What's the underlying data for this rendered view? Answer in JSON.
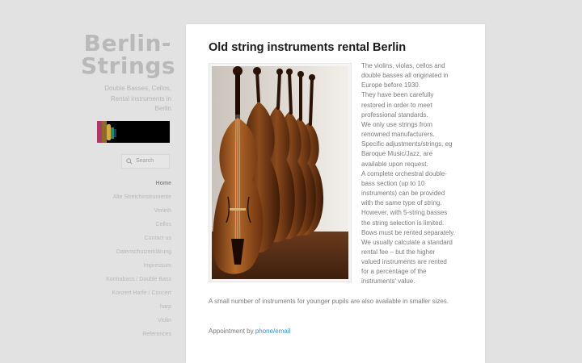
{
  "site": {
    "title_lines": [
      "Berlin-",
      "Strings"
    ],
    "description_lines": [
      "Double Basses, Cellos,",
      "Rental instruments in",
      "Berlin"
    ]
  },
  "search": {
    "placeholder": "Search"
  },
  "nav": {
    "items": [
      {
        "label": "Home"
      },
      {
        "label": "Alte Streichinstrumente"
      },
      {
        "label": "Verleih"
      },
      {
        "label": "Cellos"
      },
      {
        "label": "Contact us"
      },
      {
        "label": "Datenschutzerklärung"
      },
      {
        "label": "Impressum"
      },
      {
        "label": "Kontrabass / Double Bass"
      },
      {
        "label": "Konzert Harfe / Concert"
      },
      {
        "label": "harp"
      },
      {
        "label": "Violin"
      },
      {
        "label": "References"
      }
    ]
  },
  "page": {
    "title": "Old string instruments rental Berlin",
    "body_lines": [
      "The violins, violas, cellos and",
      "double basses all originated in",
      "Europe before 1930.",
      "They have been carefully",
      "restored in order to meet",
      "professional standards.",
      "We only use strings from",
      "renowned manufacturers.",
      "Specific adjustments/strings, eg",
      "Baroque Music/Jazz, are",
      "available upon request.",
      "A complete orchestral double-",
      "bass section (up to 10",
      "instruments) can be provided",
      "with the same type of string.",
      "However, with 5-string basses",
      "the string selection is limited.",
      "Bows must be rented separately.",
      "We usually calculate a standard",
      "rental fee – but the higher",
      "valued instruments are rented",
      "for a percentage of the",
      "instruments' value."
    ],
    "small_note": "A small number of instruments for younger pupils are also available in smaller sizes.",
    "appointment_prefix": "Appointment by ",
    "appointment_link": "phone/email"
  }
}
